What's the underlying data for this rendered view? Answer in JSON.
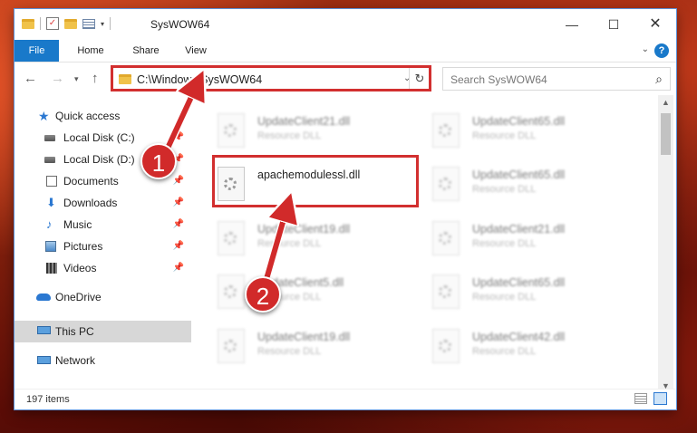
{
  "window": {
    "title": "SysWOW64"
  },
  "window_controls": {
    "minimize": "—",
    "maximize": "☐",
    "close": "✕"
  },
  "ribbon": {
    "tabs": [
      "File",
      "Home",
      "Share",
      "View"
    ],
    "help": "?"
  },
  "navigation": {
    "back": "←",
    "forward": "→",
    "recent": "▾",
    "up": "↑"
  },
  "address_bar": {
    "path": "C:\\Windows\\SysWOW64",
    "refresh": "↻"
  },
  "search": {
    "placeholder": "Search SysWOW64"
  },
  "sidebar": {
    "items": [
      {
        "label": "Quick access",
        "icon": "star-icon",
        "pinned": false
      },
      {
        "label": "Local Disk (C:)",
        "icon": "drive-icon",
        "pinned": true
      },
      {
        "label": "Local Disk (D:)",
        "icon": "drive-icon",
        "pinned": true
      },
      {
        "label": "Documents",
        "icon": "document-icon",
        "pinned": true
      },
      {
        "label": "Downloads",
        "icon": "download-icon",
        "pinned": true
      },
      {
        "label": "Music",
        "icon": "music-icon",
        "pinned": true
      },
      {
        "label": "Pictures",
        "icon": "pictures-icon",
        "pinned": true
      },
      {
        "label": "Videos",
        "icon": "videos-icon",
        "pinned": true
      },
      {
        "label": "OneDrive",
        "icon": "cloud-icon",
        "pinned": false
      },
      {
        "label": "This PC",
        "icon": "computer-icon",
        "pinned": false,
        "selected": true
      },
      {
        "label": "Network",
        "icon": "network-icon",
        "pinned": false
      }
    ]
  },
  "files": [
    {
      "name": "UpdateClient21.dll",
      "type": "Resource DLL",
      "blurred": true
    },
    {
      "name": "UpdateClient65.dll",
      "type": "Resource DLL",
      "blurred": true
    },
    {
      "name": "apachemodulessl.dll",
      "type": "",
      "blurred": false,
      "highlighted": true
    },
    {
      "name": "UpdateClient65.dll",
      "type": "Resource DLL",
      "blurred": true
    },
    {
      "name": "UpdateClient19.dll",
      "type": "Resource DLL",
      "blurred": true
    },
    {
      "name": "UpdateClient21.dll",
      "type": "Resource DLL",
      "blurred": true
    },
    {
      "name": "UpdateClient5.dll",
      "type": "Resource DLL",
      "blurred": true
    },
    {
      "name": "UpdateClient65.dll",
      "type": "Resource DLL",
      "blurred": true
    },
    {
      "name": "UpdateClient19.dll",
      "type": "Resource DLL",
      "blurred": true
    },
    {
      "name": "UpdateClient42.dll",
      "type": "Resource DLL",
      "blurred": true
    }
  ],
  "status": {
    "item_count": "197 items"
  },
  "annotations": {
    "step1": "1",
    "step2": "2",
    "color": "#d12a2a"
  },
  "colors": {
    "accent": "#1979ca",
    "highlight": "#d22f2f"
  }
}
